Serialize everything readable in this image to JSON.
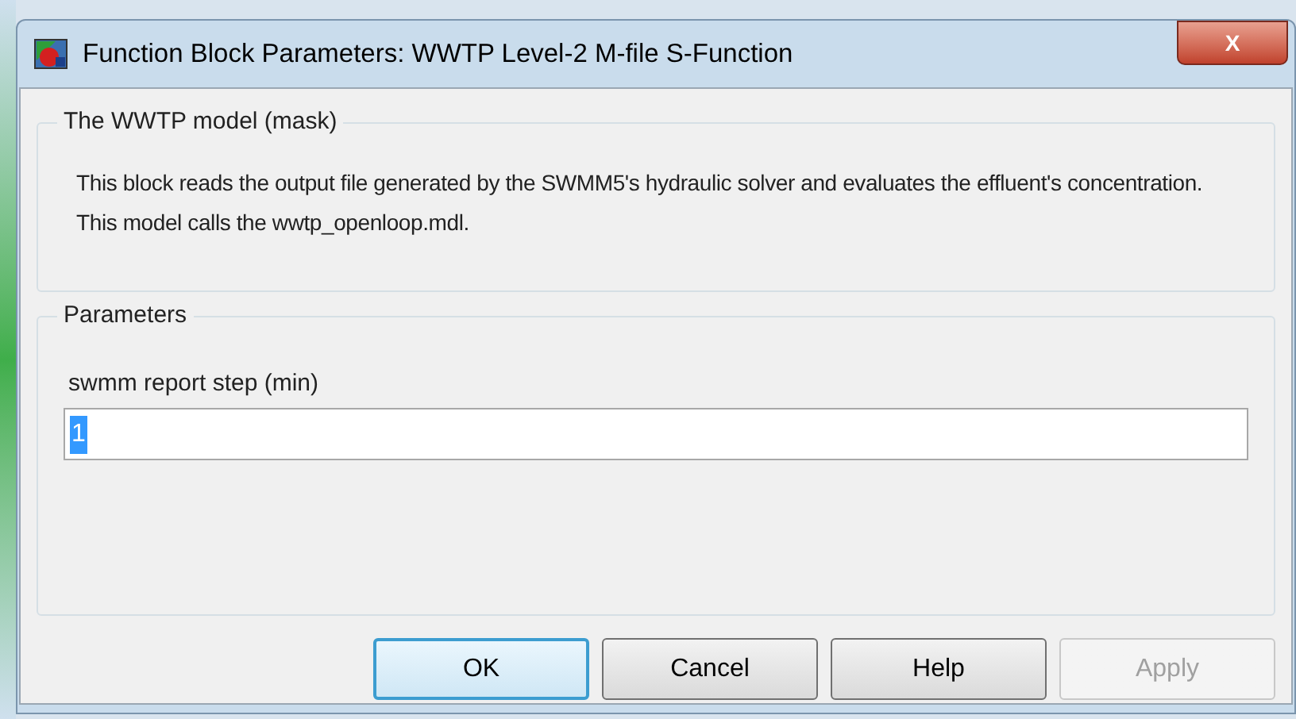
{
  "window": {
    "title": "Function Block Parameters: WWTP Level-2 M-file S-Function",
    "close": "X"
  },
  "mask_group": {
    "legend": "The WWTP model (mask)",
    "description": "This block reads the output file generated by the SWMM5's hydraulic solver and evaluates the effluent's concentration. This model calls the wwtp_openloop.mdl."
  },
  "parameters_group": {
    "legend": "Parameters",
    "fields": [
      {
        "label": "swmm report step (min)",
        "value": "1",
        "value_selected": true
      }
    ]
  },
  "buttons": [
    {
      "label": "OK",
      "default": true,
      "disabled": false
    },
    {
      "label": "Cancel",
      "default": false,
      "disabled": false
    },
    {
      "label": "Help",
      "default": false,
      "disabled": false
    },
    {
      "label": "Apply",
      "default": false,
      "disabled": true
    }
  ]
}
